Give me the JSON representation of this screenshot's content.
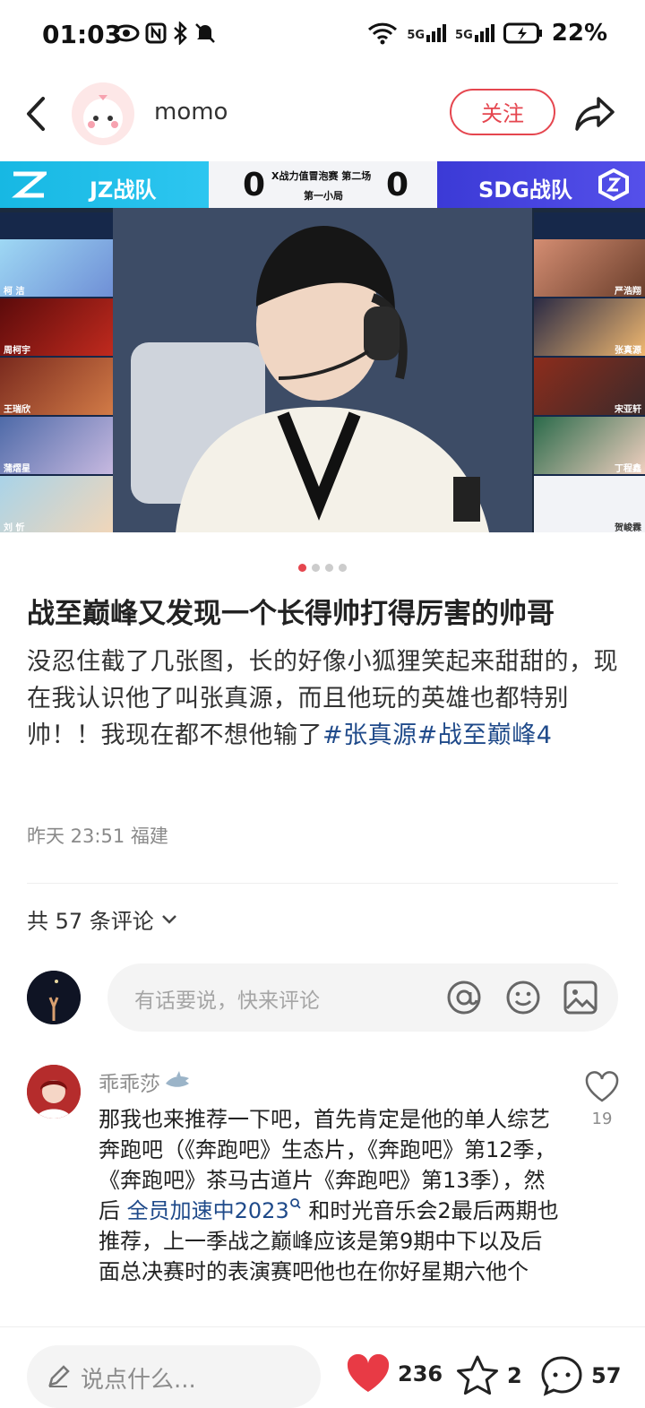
{
  "status_bar": {
    "time": "01:03",
    "battery": "22%",
    "signal_labels": [
      "5G",
      "5G"
    ]
  },
  "header": {
    "username": "momo",
    "follow_label": "关注"
  },
  "media": {
    "left_team": "JZ战队",
    "right_team": "SDG战队",
    "left_score": "0",
    "right_score": "0",
    "match_title": "X战力值冒泡赛 第二场",
    "round": "第一小局",
    "left_players": [
      "柯 洁",
      "周柯宇",
      "王瑞欣",
      "蒲熠星",
      "刘 忻"
    ],
    "right_players": [
      "严浩翔",
      "张真源",
      "宋亚轩",
      "丁程鑫",
      "贺峻霖"
    ]
  },
  "carousel": {
    "count": 4,
    "active_index": 0
  },
  "post": {
    "title": "战至巅峰又发现一个长得帅打得厉害的帅哥",
    "body_text": "没忍住截了几张图，长的好像小狐狸笑起来甜甜的，现在我认识他了叫张真源，而且他玩的英雄也都特别帅！！我现在都不想他输了",
    "tags": [
      "#张真源",
      "#战至巅峰4"
    ],
    "meta": "昨天 23:51 福建"
  },
  "comments_section": {
    "count_label": "共 57 条评论",
    "input_placeholder": "有话要说，快来评论"
  },
  "comment": {
    "author": "乖乖莎",
    "text_before_link": "那我也来推荐一下吧，首先肯定是他的单人综艺奔跑吧（《奔跑吧》生态片，《奔跑吧》第12季，《奔跑吧》茶马古道片《奔跑吧》第13季），然后 ",
    "link_text": "全员加速中2023",
    "text_after_link": " 和时光音乐会2最后两期也推荐，上一季战之巅峰应该是第9期中下以及后面总决赛时的表演赛吧他也在你好星期六他个",
    "likes": "19"
  },
  "bottom_bar": {
    "input_placeholder": "说点什么...",
    "likes": "236",
    "collects": "2",
    "comments": "57"
  },
  "colors": {
    "accent": "#e5464f",
    "link": "#1f4a8a",
    "muted": "#8c8c8c"
  }
}
